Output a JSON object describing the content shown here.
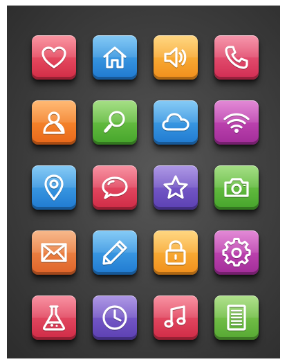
{
  "icon_grid": {
    "tiles": [
      {
        "icon": "heart-icon",
        "color_top": "#f8687a",
        "color_bottom": "#d12b45"
      },
      {
        "icon": "home-icon",
        "color_top": "#4fb2f0",
        "color_bottom": "#1f78cf"
      },
      {
        "icon": "speaker-icon",
        "color_top": "#ffc54c",
        "color_bottom": "#f08e1b"
      },
      {
        "icon": "phone-icon",
        "color_top": "#f26a88",
        "color_bottom": "#d12c52"
      },
      {
        "icon": "user-icon",
        "color_top": "#ff9c3a",
        "color_bottom": "#e8671a"
      },
      {
        "icon": "magnifier-icon",
        "color_top": "#7fd152",
        "color_bottom": "#45a42b"
      },
      {
        "icon": "cloud-icon",
        "color_top": "#52b4f2",
        "color_bottom": "#1f79d0"
      },
      {
        "icon": "wifi-icon",
        "color_top": "#d657c4",
        "color_bottom": "#a12c98"
      },
      {
        "icon": "location-pin-icon",
        "color_top": "#52b4f2",
        "color_bottom": "#1f79d0"
      },
      {
        "icon": "speech-bubble-icon",
        "color_top": "#f4637a",
        "color_bottom": "#cf2a45"
      },
      {
        "icon": "star-icon",
        "color_top": "#8b6cda",
        "color_bottom": "#5b40b2"
      },
      {
        "icon": "camera-icon",
        "color_top": "#7fd152",
        "color_bottom": "#45a42b"
      },
      {
        "icon": "mail-envelope-icon",
        "color_top": "#f49a5a",
        "color_bottom": "#df6328"
      },
      {
        "icon": "pencil-icon",
        "color_top": "#52b4f2",
        "color_bottom": "#1f79d0"
      },
      {
        "icon": "padlock-icon",
        "color_top": "#ffc54c",
        "color_bottom": "#f08e1b"
      },
      {
        "icon": "gear-icon",
        "color_top": "#d657c4",
        "color_bottom": "#a12c98"
      },
      {
        "icon": "flask-icon",
        "color_top": "#f4637a",
        "color_bottom": "#cf2a45"
      },
      {
        "icon": "clock-icon",
        "color_top": "#8b6cda",
        "color_bottom": "#5b40b2"
      },
      {
        "icon": "music-note-icon",
        "color_top": "#f4637a",
        "color_bottom": "#cf2a45"
      },
      {
        "icon": "document-icon",
        "color_top": "#8fd45c",
        "color_bottom": "#55a832"
      }
    ]
  },
  "colors": {
    "background_center": "#585858",
    "background_edge": "#2c2c2c",
    "glyph": "#ffffff"
  }
}
